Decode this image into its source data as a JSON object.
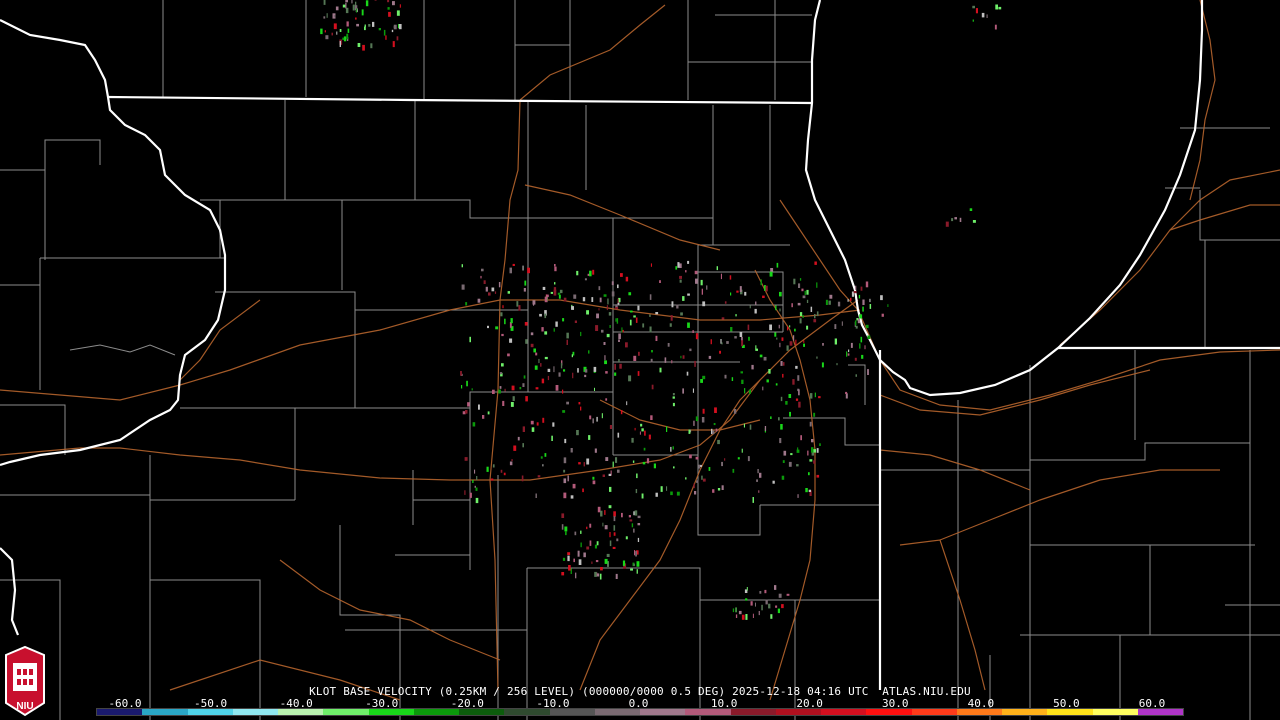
{
  "product": {
    "caption": "KLOT BASE VELOCITY (0.25KM / 256 LEVEL) (000000/0000 0.5 DEG) 2025-12-18 04:16 UTC  ATLAS.NIU.EDU"
  },
  "colorbar": {
    "ticks": [
      "-60.0",
      "-50.0",
      "-40.0",
      "-30.0",
      "-20.0",
      "-10.0",
      "0.0",
      "10.0",
      "20.0",
      "30.0",
      "40.0",
      "50.0",
      "60.0"
    ],
    "colors": [
      "#1a1a6e",
      "#2aa7c6",
      "#4fd3e8",
      "#8fe8f0",
      "#b9f3b0",
      "#6ff06a",
      "#19d81a",
      "#0b9a0b",
      "#0c5c0c",
      "#2f4a2f",
      "#555555",
      "#7a6a72",
      "#a0788c",
      "#b35a7a",
      "#8a1a2a",
      "#b0101f",
      "#d40f1f",
      "#ff1010",
      "#ff3b1a",
      "#ff7a1a",
      "#ffb21a",
      "#ffe31a",
      "#ffff60",
      "#b035c8"
    ]
  },
  "logo": {
    "label": "NIU",
    "colors": {
      "shield": "#c8102e",
      "outline": "#ffffff"
    }
  },
  "map_colors": {
    "state_border": "#ffffff",
    "county_border": "#9a9a9a",
    "highway": "#b5642d",
    "background": "#000000"
  }
}
